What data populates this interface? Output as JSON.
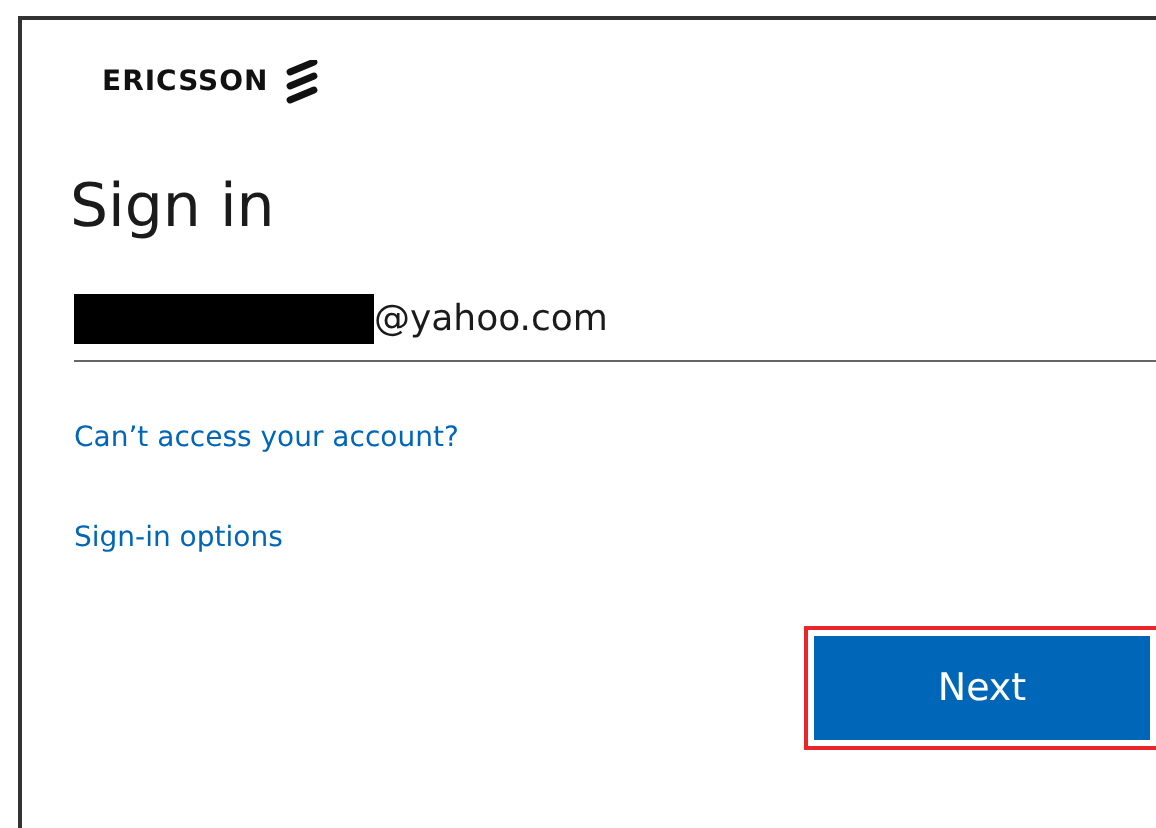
{
  "logo": {
    "text": "ERICSSON"
  },
  "title": "Sign in",
  "email_field": {
    "value": "@yahoo.com",
    "redacted": true
  },
  "links": [
    {
      "label": "Can’t access your account?"
    },
    {
      "label": "Sign-in options"
    }
  ],
  "next_button": {
    "label": "Next",
    "highlighted": true
  }
}
